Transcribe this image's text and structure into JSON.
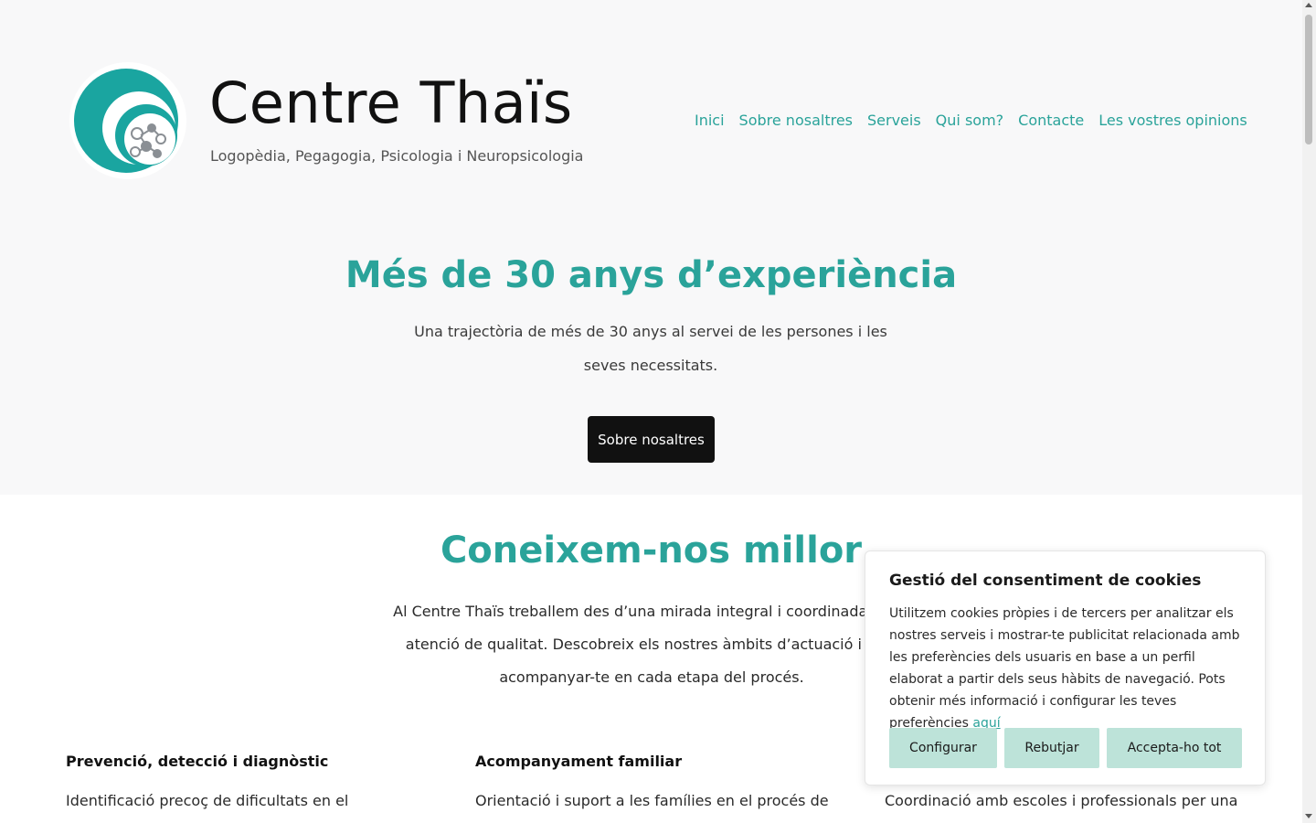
{
  "header": {
    "title": "Centre Thaïs",
    "tagline": "Logopèdia, Pegagogia, Psicologia i Neuropsicologia",
    "logo_icon": "brain-circuit-logo-icon",
    "nav": [
      {
        "label": "Inici"
      },
      {
        "label": "Sobre nosaltres"
      },
      {
        "label": "Serveis"
      },
      {
        "label": "Qui som?"
      },
      {
        "label": "Contacte"
      },
      {
        "label": "Les vostres opinions"
      }
    ]
  },
  "hero": {
    "title": "Més de 30 anys d’experiència",
    "text": "Una trajectòria de més de 30 anys al servei de les persones i les seves necessitats.",
    "button_label": "Sobre nosaltres"
  },
  "about": {
    "title": "Coneixem-nos millor",
    "text": "Al Centre Thaïs treballem des d’una mirada integral i coordinada per o atenció de qualitat. Descobreix els nostres àmbits d’actuació i com acompanyar-te en cada etapa del procés.",
    "columns": [
      {
        "title": "Prevenció, detecció i diagnòstic",
        "text": "Identificació precoç de dificultats en el"
      },
      {
        "title": "Acompanyament familiar",
        "text": "Orientació i suport a les famílies en el procés de"
      },
      {
        "title": "",
        "text": "Coordinació amb escoles i professionals per una"
      }
    ]
  },
  "cookies": {
    "title": "Gestió del consentiment de cookies",
    "text": "Utilitzem cookies pròpies i de tercers per analitzar els nostres serveis i mostrar-te publicitat relacionada amb les preferències dels usuaris en base a un perfil elaborat a partir dels seus hàbits de navegació. Pots obtenir més informació i configurar les teves preferències",
    "link_label": "aquí",
    "buttons": {
      "configure": "Configurar",
      "reject": "Rebutjar",
      "accept": "Accepta-ho tot"
    }
  },
  "colors": {
    "accent": "#2aa39a",
    "button_dark": "#111111",
    "cookie_button": "#bde3d9",
    "band_bg": "#f8f8f9"
  }
}
